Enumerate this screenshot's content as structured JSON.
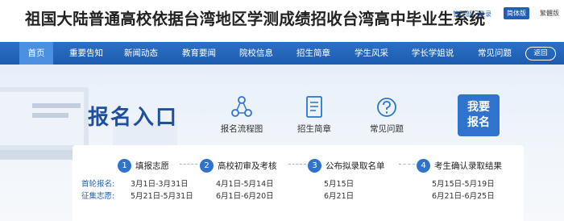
{
  "header": {
    "title": "祖国大陆普通高校依据台湾地区学测成绩招收台湾高中毕业生系统",
    "admin_login": "管理部门登录",
    "lang_simplified": "简体版",
    "lang_traditional": "繁體版"
  },
  "nav": {
    "items": [
      {
        "label": "首页",
        "active": true
      },
      {
        "label": "重要告知"
      },
      {
        "label": "新闻动态"
      },
      {
        "label": "教育要闻"
      },
      {
        "label": "院校信息"
      },
      {
        "label": "招生简章"
      },
      {
        "label": "学生风采"
      },
      {
        "label": "学长学姐说"
      },
      {
        "label": "常见问题"
      }
    ],
    "back_label": "返回"
  },
  "banner": {
    "title": "报名入口",
    "quick_links": [
      {
        "label": "报名流程图",
        "icon": "flow-chart-icon"
      },
      {
        "label": "招生简章",
        "icon": "document-icon"
      },
      {
        "label": "常见问题",
        "icon": "question-icon"
      }
    ],
    "apply_button": {
      "line1": "我要",
      "line2": "报名"
    }
  },
  "timeline": {
    "steps": [
      {
        "num": "1",
        "label": "填报志愿"
      },
      {
        "num": "2",
        "label": "高校初审及考核"
      },
      {
        "num": "3",
        "label": "公布拟录取名单"
      },
      {
        "num": "4",
        "label": "考生确认录取结果"
      }
    ],
    "rows": [
      {
        "label": "首轮报名:",
        "dates": [
          "3月1日-3月31日",
          "4月1日-5月14日",
          "5月15日",
          "5月15日-5月19日"
        ]
      },
      {
        "label": "征集志愿:",
        "dates": [
          "5月21日-5月31日",
          "6月1日-6月20日",
          "6月21日",
          "6月21日-6月25日"
        ]
      }
    ]
  },
  "colors": {
    "brand_blue": "#1e5fb5",
    "nav_active": "#4a8fe0",
    "title_blue": "#1e4fa0"
  }
}
